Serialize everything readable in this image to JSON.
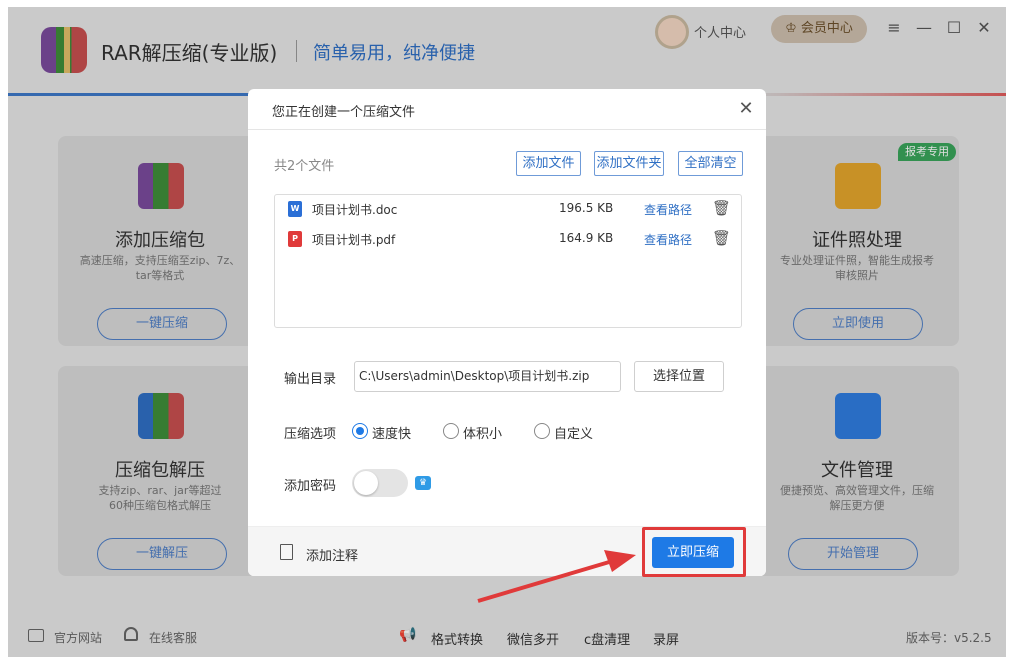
{
  "app": {
    "title": "RAR解压缩(专业版)",
    "tagline": "简单易用，纯净便捷",
    "personal_center": "个人中心",
    "vip_center": "会员中心",
    "window_menu_icon": "≡",
    "window_min_icon": "—",
    "window_max_icon": "☐",
    "window_close_icon": "✕"
  },
  "cards": [
    {
      "title": "添加压缩包",
      "desc_line1": "高速压缩，支持压缩至zip、7z、",
      "desc_line2": "tar等格式",
      "button": "一键压缩"
    },
    {
      "title": "证件照处理",
      "desc_line1": "专业处理证件照，智能生成报考",
      "desc_line2": "审核照片",
      "button": "立即使用",
      "badge": "报考专用"
    },
    {
      "title": "压缩包解压",
      "desc_line1": "支持zip、rar、jar等超过",
      "desc_line2": "60种压缩包格式解压",
      "button": "一键解压"
    },
    {
      "title": "文件管理",
      "desc_line1": "便捷预览、高效管理文件，压缩",
      "desc_line2": "解压更方便",
      "button": "开始管理"
    }
  ],
  "footer": {
    "website": "官方网站",
    "support": "在线客服",
    "tools": [
      "格式转换",
      "微信多开",
      "c盘清理",
      "录屏"
    ],
    "version": "版本号：v5.2.5"
  },
  "dialog": {
    "title": "您正在创建一个压缩文件",
    "close_icon": "✕",
    "file_count": "共2个文件",
    "add_file": "添加文件",
    "add_folder": "添加文件夹",
    "clear_all": "全部清空",
    "files": [
      {
        "name": "项目计划书.doc",
        "size": "196.5 KB",
        "action": "查看路径",
        "type_label": "W",
        "color": "#2b6fd6"
      },
      {
        "name": "项目计划书.pdf",
        "size": "164.9 KB",
        "action": "查看路径",
        "type_label": "P",
        "color": "#e03a3a"
      }
    ],
    "output_label": "输出目录",
    "output_path": "C:\\Users\\admin\\Desktop\\项目计划书.zip",
    "choose_location": "选择位置",
    "options_label": "压缩选项",
    "options": [
      "速度快",
      "体积小",
      "自定义"
    ],
    "selected_option": "速度快",
    "password_label": "添加密码",
    "password_enabled": false,
    "note_label": "添加注释",
    "compress_button": "立即压缩"
  },
  "colors": {
    "accent": "#1e7ae6",
    "link": "#2f6fc4",
    "highlight_box": "#e03a3a"
  }
}
